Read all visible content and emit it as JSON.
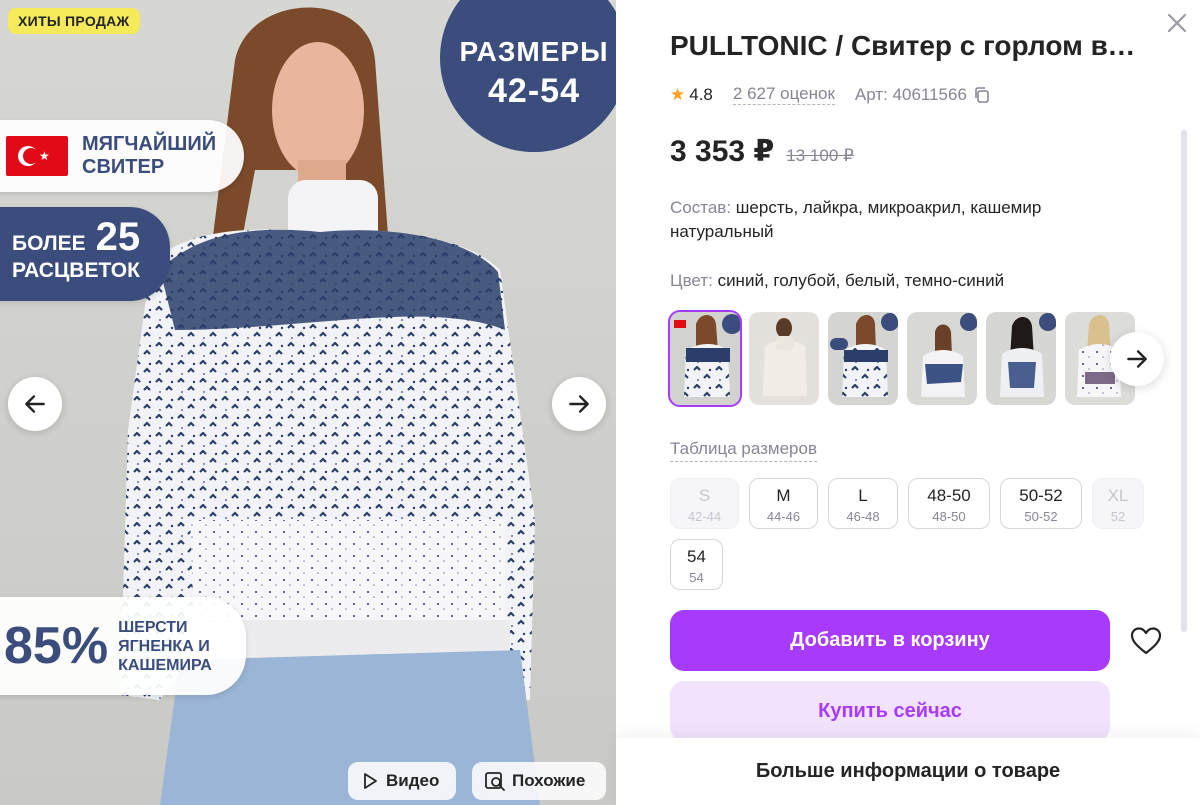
{
  "gallery": {
    "badge": "ХИТЫ ПРОДАЖ",
    "promo_sizes": {
      "line1": "РАЗМЕРЫ",
      "line2": "42-54"
    },
    "promo_soft": {
      "line1": "МЯГЧАЙШИЙ",
      "line2": "СВИТЕР"
    },
    "promo_colors": {
      "word1": "БОЛЕЕ",
      "number": "25",
      "word2": "РАСЦВЕТОК"
    },
    "promo_wool": {
      "percent": "85%",
      "line1": "ШЕРСТИ",
      "line2": "ЯГНЕНКА И",
      "line3": "КАШЕМИРА"
    },
    "video_label": "Видео",
    "similar_label": "Похожие"
  },
  "product": {
    "title": "PULLTONIC / Свитер с горлом вязаный",
    "rating": "4.8",
    "reviews": "2 627 оценок",
    "article": "Арт: 40611566",
    "price": "3 353 ₽",
    "old_price": "13 100 ₽",
    "composition_label": "Состав:",
    "composition_value": "шерсть, лайкра, микроакрил, кашемир натуральный",
    "color_label": "Цвет:",
    "color_value": "синий, голубой, белый, темно-синий",
    "size_table_label": "Таблица размеров",
    "sizes": [
      {
        "label": "S",
        "ru": "42-44",
        "available": false
      },
      {
        "label": "M",
        "ru": "44-46",
        "available": true
      },
      {
        "label": "L",
        "ru": "46-48",
        "available": true
      },
      {
        "label": "48-50",
        "ru": "48-50",
        "available": true
      },
      {
        "label": "50-52",
        "ru": "50-52",
        "available": true
      },
      {
        "label": "XL",
        "ru": "52",
        "available": false
      },
      {
        "label": "54",
        "ru": "54",
        "available": true
      }
    ],
    "add_to_cart_label": "Добавить в корзину",
    "buy_now_label": "Купить сейчас",
    "more_info_label": "Больше информации о товаре"
  },
  "colors": {
    "accent": "#a73afd",
    "accent_light": "#f1e3fe",
    "navy": "#3b4d7c",
    "badge_yellow": "#f5ea5a",
    "star": "#ff9f1c"
  }
}
